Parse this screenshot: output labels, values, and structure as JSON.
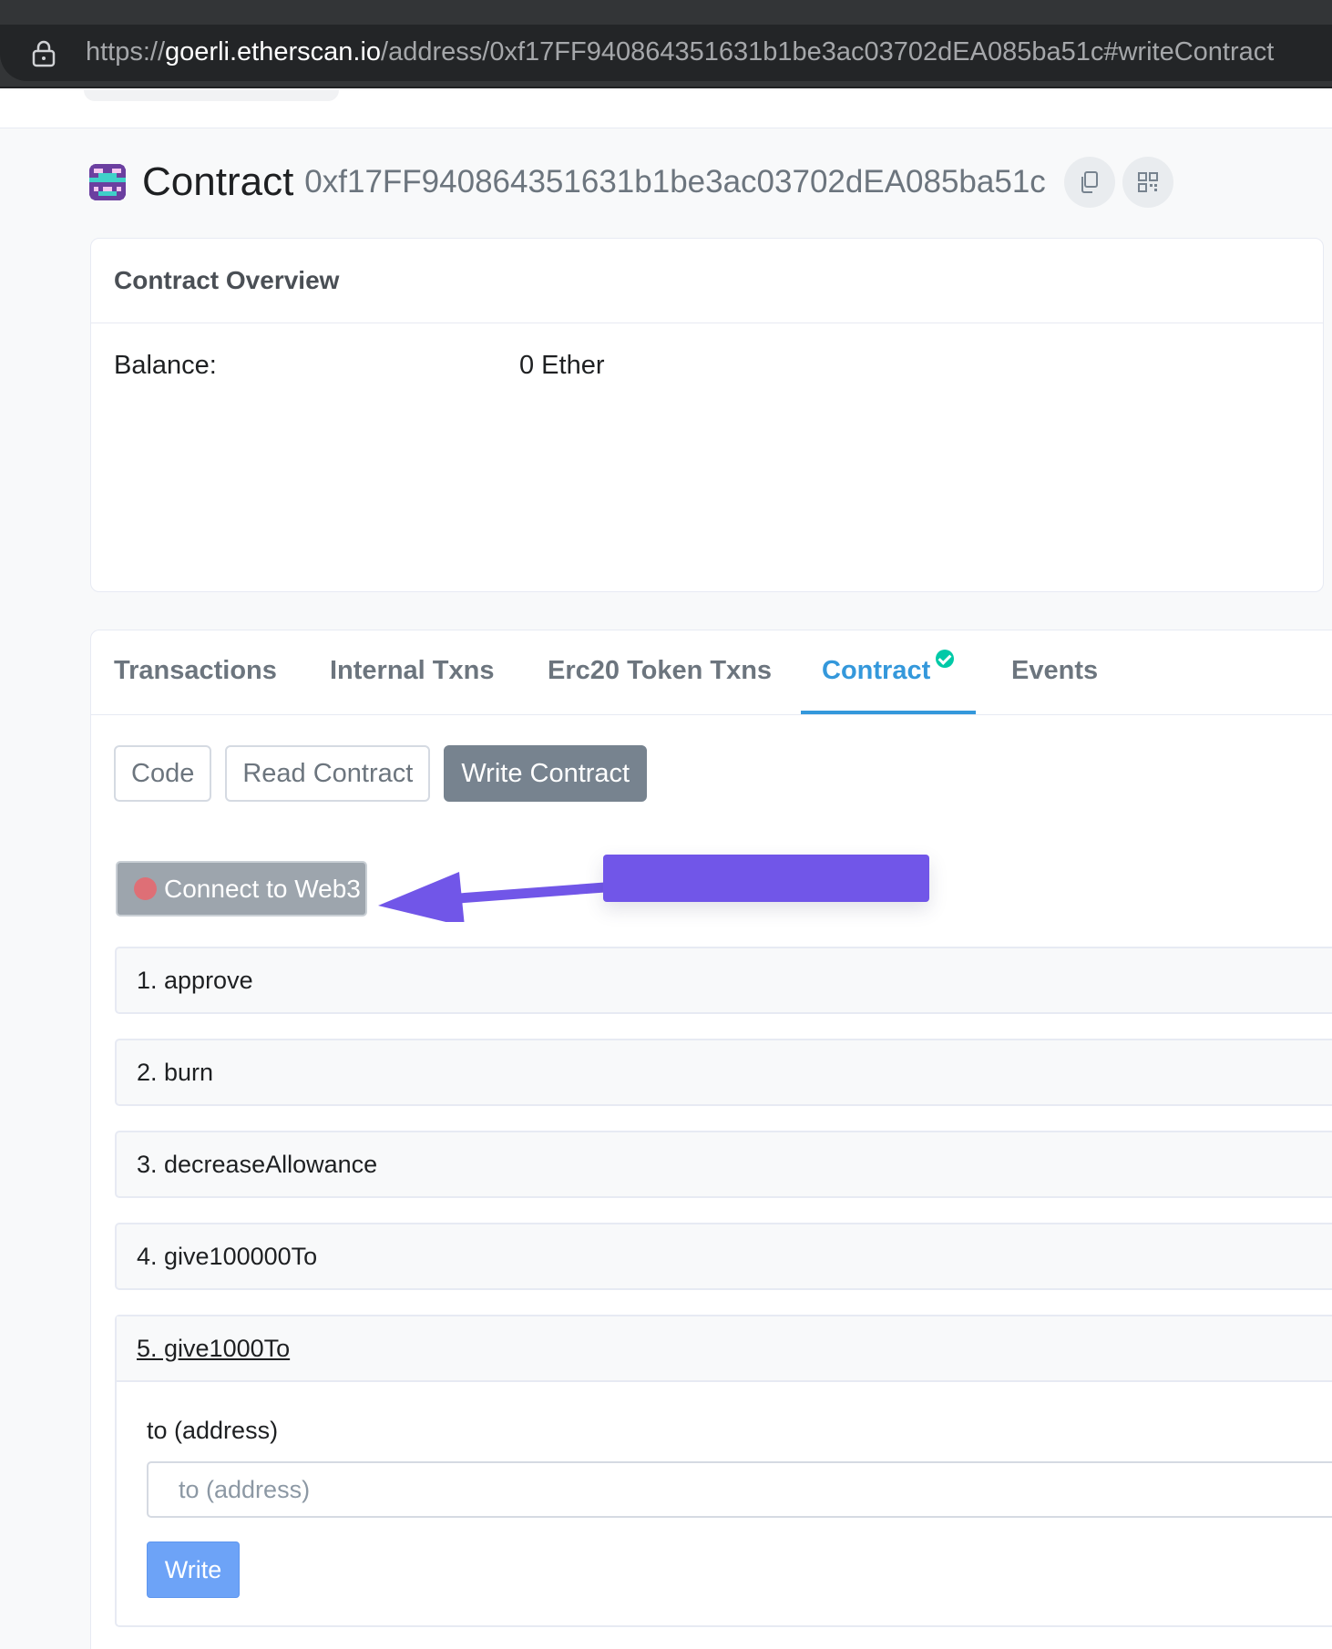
{
  "browser": {
    "url_scheme": "https://",
    "url_host": "goerli.etherscan.io",
    "url_path": "/address/0xf17FF940864351631b1be3ac03702dEA085ba51c#writeContract"
  },
  "header": {
    "title": "Contract",
    "address": "0xf17FF940864351631b1be3ac03702dEA085ba51c",
    "copy_icon": "copy-icon",
    "qr_icon": "qr-code-icon"
  },
  "overview": {
    "title": "Contract Overview",
    "balance_label": "Balance:",
    "balance_value": "0 Ether"
  },
  "tabs": [
    {
      "label": "Transactions",
      "active": false
    },
    {
      "label": "Internal Txns",
      "active": false
    },
    {
      "label": "Erc20 Token Txns",
      "active": false
    },
    {
      "label": "Contract",
      "active": true,
      "verified": true
    },
    {
      "label": "Events",
      "active": false
    }
  ],
  "subtabs": [
    {
      "label": "Code",
      "active": false
    },
    {
      "label": "Read Contract",
      "active": false
    },
    {
      "label": "Write Contract",
      "active": true
    }
  ],
  "connect": {
    "label": "Connect to Web3",
    "status_color": "#de6f76"
  },
  "annotation": {
    "arrow_color": "#7156e8",
    "box_color": "#7156e8"
  },
  "functions": [
    {
      "label": "1. approve"
    },
    {
      "label": "2. burn"
    },
    {
      "label": "3. decreaseAllowance"
    },
    {
      "label": "4. give100000To"
    },
    {
      "label": "5. give1000To",
      "expanded": true
    }
  ],
  "expanded_function": {
    "param_label": "to (address)",
    "param_placeholder": "to (address)",
    "write_label": "Write"
  },
  "colors": {
    "accent": "#3498db",
    "verified": "#00c9a7",
    "write_button": "#6da3f7"
  }
}
